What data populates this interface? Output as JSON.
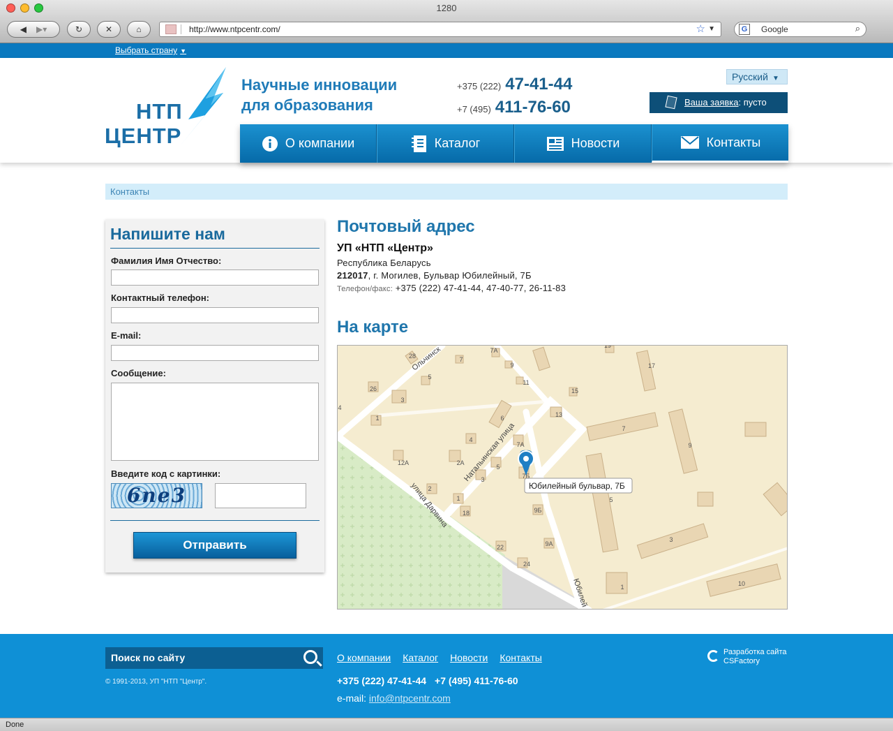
{
  "browser": {
    "window_title": "1280",
    "url": "http://www.ntpcentr.com/",
    "search_engine": "Google",
    "status": "Done",
    "lights": [
      "#ff5f57",
      "#febc2e",
      "#28c840"
    ]
  },
  "topbar": {
    "country_label": "Выбрать страну"
  },
  "header": {
    "logo_line1": "НТП",
    "logo_line2": "ЦЕНТР",
    "tagline_line1": "Научные инновации",
    "tagline_line2": "для образования",
    "phones": [
      {
        "code": "+375 (222)",
        "number": "47-41-44"
      },
      {
        "code": "+7 (495)",
        "number": "411-76-60"
      }
    ],
    "language": "Русский",
    "cart_link": "Ваша заявка",
    "cart_status": ": пусто"
  },
  "menu": [
    {
      "label": "О компании",
      "icon": "info-icon"
    },
    {
      "label": "Каталог",
      "icon": "catalog-icon"
    },
    {
      "label": "Новости",
      "icon": "newspaper-icon"
    },
    {
      "label": "Контакты",
      "icon": "envelope-icon"
    }
  ],
  "breadcrumb": "Контакты",
  "form": {
    "title": "Напишите нам",
    "name_label": "Фамилия Имя Отчество:",
    "phone_label": "Контактный телефон:",
    "email_label": "E-mail:",
    "message_label": "Сообщение:",
    "captcha_label": "Введите код с картинки:",
    "captcha_text": "6ne3",
    "submit_label": "Отправить"
  },
  "address": {
    "title": "Почтовый адрес",
    "org": "УП «НТП «Центр»",
    "country": "Республика Беларусь",
    "postal_code": "212017",
    "street": ", г. Могилев, Бульвар Юбилейный, 7Б",
    "phone_label": "Телефон/факс:",
    "phone_value": " +375 (222) 47-41-44, 47-40-77, 26-11-83"
  },
  "map": {
    "title": "На карте",
    "marker_label": "Юбилейный бульвар, 7Б",
    "streets": [
      "Натальинская улица",
      "улица Дарвина",
      "Ольчинск",
      "Юбилей"
    ],
    "building_numbers": [
      "28",
      "7",
      "7А",
      "9",
      "11",
      "19",
      "17",
      "5",
      "26",
      "3",
      "15",
      "4",
      "1",
      "6",
      "13",
      "7",
      "9",
      "4",
      "7А",
      "12А",
      "2А",
      "5",
      "3",
      "7Б",
      "2",
      "1",
      "18",
      "9Б",
      "5",
      "22",
      "9А",
      "3",
      "24",
      "1",
      "10"
    ]
  },
  "footer": {
    "search_placeholder": "Поиск по сайту",
    "copyright": "© 1991-2013, УП \"НТП \"Центр\".",
    "links": [
      "О компании",
      "Каталог",
      "Новости",
      "Контакты"
    ],
    "phone1": "+375 (222) 47-41-44",
    "phone2": "+7 (495) 411-76-60",
    "email_label": "e-mail: ",
    "email": "info@ntpcentr.com",
    "dev_line1": "Разработка сайта",
    "dev_line2": "CSFactory"
  }
}
